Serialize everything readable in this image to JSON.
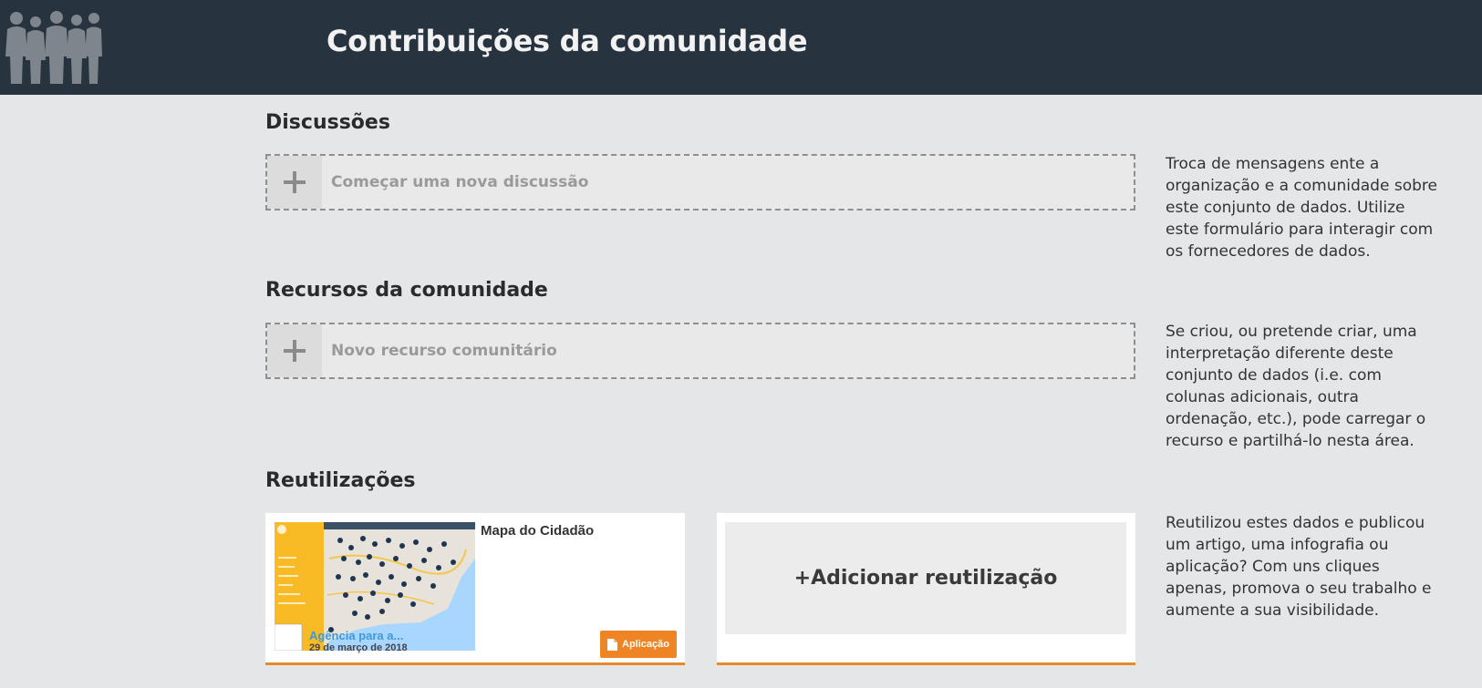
{
  "header": {
    "title": "Contribuições da comunidade",
    "logo_icon": "people-silhouettes-icon"
  },
  "discussions": {
    "title": "Discussões",
    "add_label": "Começar uma nova discussão",
    "description": "Troca de mensagens ente a organização e a comunidade sobre este conjunto de dados. Utilize este formulário para interagir com os fornecedores de dados."
  },
  "community_resources": {
    "title": "Recursos da comunidade",
    "add_label": "Novo recurso comunitário",
    "description": "Se criou, ou pretende criar, uma interpretação diferente deste conjunto de dados (i.e. com colunas adicionais, outra ordenação, etc.), pode carregar o recurso e partilhá-lo nesta área."
  },
  "reuses": {
    "title": "Reutilizações",
    "items": [
      {
        "title": "Mapa do Cidadão",
        "organization": "Agência para a...",
        "date": "29 de março de 2018",
        "badge": "Aplicação"
      }
    ],
    "add_label": "+Adicionar reutilização",
    "description": "Reutilizou estes dados e publicou um artigo, uma infografia ou aplicação? Com uns cliques apenas, promova o seu trabalho e aumente a sua visibilidade."
  },
  "colors": {
    "header_bg": "#27333e",
    "page_bg": "#e5e6e8",
    "accent_orange": "#ee8424"
  }
}
